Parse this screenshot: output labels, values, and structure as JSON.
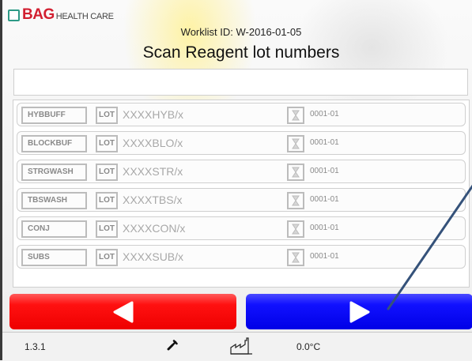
{
  "logo": {
    "brand": "BAG",
    "subtitle": "HEALTH CARE"
  },
  "header": {
    "worklist": "Worklist ID:  W-2016-01-05",
    "title": "Scan Reagent lot numbers"
  },
  "scan_input": {
    "value": "",
    "placeholder": ""
  },
  "lot_label": "LOT",
  "reagents": [
    {
      "name": "HYBBUFF",
      "lot": "XXXXHYB/x",
      "code": "0001-01"
    },
    {
      "name": "BLOCKBUF",
      "lot": "XXXXBLO/x",
      "code": "0001-01"
    },
    {
      "name": "STRGWASH",
      "lot": "XXXXSTR/x",
      "code": "0001-01"
    },
    {
      "name": "TBSWASH",
      "lot": "XXXXTBS/x",
      "code": "0001-01"
    },
    {
      "name": "CONJ",
      "lot": "XXXXCON/x",
      "code": "0001-01"
    },
    {
      "name": "SUBS",
      "lot": "XXXXSUB/x",
      "code": "0001-01"
    }
  ],
  "buttons": {
    "back": {
      "icon": "triangle-left-icon",
      "color": "#ff0000"
    },
    "next": {
      "icon": "triangle-right-icon",
      "color": "#0000ff"
    }
  },
  "footer": {
    "version": "1.3.1",
    "wrench_icon": "wrench-icon",
    "factory_icon": "factory-icon",
    "temperature": "0.0°C"
  },
  "colors": {
    "brand_red": "#d21f30",
    "brand_teal": "#2d9a86",
    "border_gray": "#bcbcbc"
  }
}
